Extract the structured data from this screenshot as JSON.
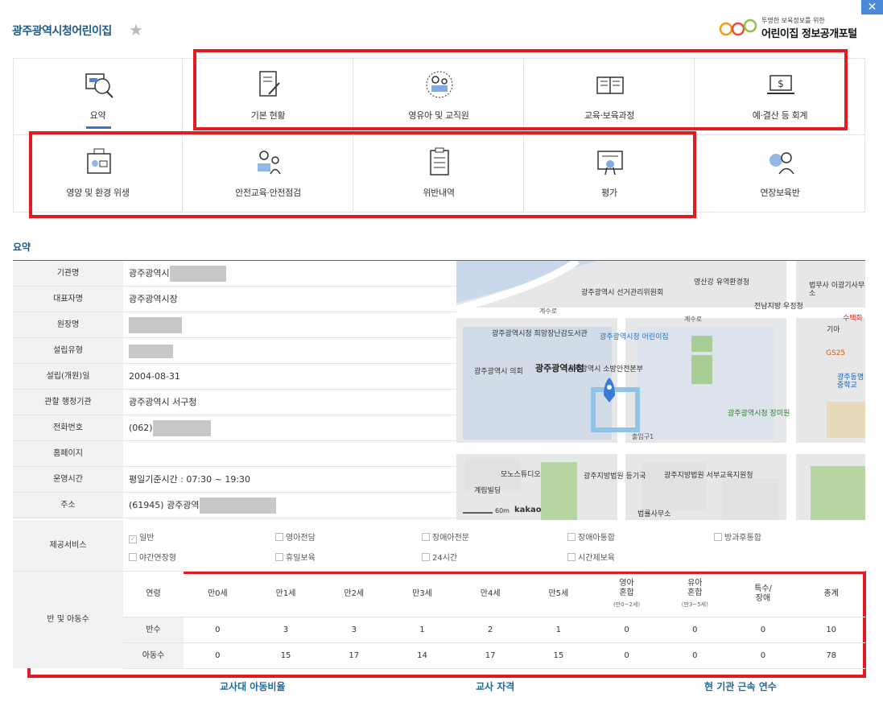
{
  "header": {
    "title": "광주광역시청어린이집",
    "logo_tagline": "투명한 보육정보를 위한",
    "logo_name": "어린이집 정보공개포털"
  },
  "tiles": [
    {
      "label": "요약",
      "icon": "magnifier-chart-icon",
      "active": true
    },
    {
      "label": "기본 현황",
      "icon": "notebook-pen-icon"
    },
    {
      "label": "영유아 및 교직원",
      "icon": "teacher-child-icon"
    },
    {
      "label": "교육·보육과정",
      "icon": "open-book-icon"
    },
    {
      "label": "예·결산 등 회계",
      "icon": "laptop-dollar-icon"
    },
    {
      "label": "영양 및 환경 위생",
      "icon": "chef-meal-icon"
    },
    {
      "label": "안전교육·안전점검",
      "icon": "safety-people-icon"
    },
    {
      "label": "위반내역",
      "icon": "clipboard-checklist-icon"
    },
    {
      "label": "평가",
      "icon": "certificate-icon"
    },
    {
      "label": "연장보육반",
      "icon": "night-care-icon"
    }
  ],
  "section_title": "요약",
  "info": [
    {
      "key": "기관명",
      "value": "광주광역시"
    },
    {
      "key": "대표자명",
      "value": "광주광역시장"
    },
    {
      "key": "원장명",
      "value": ""
    },
    {
      "key": "설립유형",
      "value": ""
    },
    {
      "key": "설립(개원)일",
      "value": "2004-08-31"
    },
    {
      "key": "관할 행정기관",
      "value": "광주광역시 서구청"
    },
    {
      "key": "전화번호",
      "value": "(062)"
    },
    {
      "key": "홈페이지",
      "value": ""
    },
    {
      "key": "운영시간",
      "value": "평일기준시간 : 07:30 ~ 19:30"
    },
    {
      "key": "주소",
      "value": "(61945) 광주광역"
    }
  ],
  "services": {
    "key": "제공서비스",
    "items": [
      {
        "label": "일반",
        "checked": true
      },
      {
        "label": "영아전담",
        "checked": false
      },
      {
        "label": "장애아전문",
        "checked": false
      },
      {
        "label": "장애아통합",
        "checked": false
      },
      {
        "label": "방과후통합",
        "checked": false
      },
      {
        "label": "야간연장형",
        "checked": false
      },
      {
        "label": "휴일보육",
        "checked": false
      },
      {
        "label": "24시간",
        "checked": false
      },
      {
        "label": "시간제보육",
        "checked": false
      }
    ]
  },
  "classes": {
    "key": "반 및 아동수",
    "header_label": "연령",
    "columns": [
      {
        "label": "만0세",
        "sub": ""
      },
      {
        "label": "만1세",
        "sub": ""
      },
      {
        "label": "만2세",
        "sub": ""
      },
      {
        "label": "만3세",
        "sub": ""
      },
      {
        "label": "만4세",
        "sub": ""
      },
      {
        "label": "만5세",
        "sub": ""
      },
      {
        "label": "영아\n혼합",
        "sub": "(만0~2세)"
      },
      {
        "label": "유아\n혼합",
        "sub": "(만3~5세)"
      },
      {
        "label": "특수/\n장애",
        "sub": ""
      },
      {
        "label": "총계",
        "sub": ""
      }
    ],
    "rows": [
      {
        "label": "반수",
        "values": [
          "0",
          "3",
          "3",
          "1",
          "2",
          "1",
          "0",
          "0",
          "0",
          "10"
        ]
      },
      {
        "label": "아동수",
        "values": [
          "0",
          "15",
          "17",
          "14",
          "17",
          "15",
          "0",
          "0",
          "0",
          "78"
        ]
      }
    ]
  },
  "links": [
    "교사대 아동비율",
    "교사 자격",
    "현 기관 근속 연수"
  ],
  "map": {
    "labels": [
      "광주광역시 선거관리위원회",
      "영산강 유역환경청",
      "전남지방 우정청",
      "법무사 이광기사무소",
      "계수로",
      "계수로",
      "광주광역시청 희망장난감도서관",
      "광주광역시청 어린이집",
      "광주광역시청",
      "광주광역시 의회",
      "광주광역시 소방안전본부",
      "광주광역시청 장미원",
      "수백화",
      "GS25",
      "광주동명 중학교",
      "모노스튜디오",
      "계림빌딩",
      "광주지방법원 등기국",
      "광주지방법원 서부교육지원청",
      "법률사무소",
      "출입구1",
      "기아"
    ],
    "scale": "60m",
    "brand": "kakao"
  }
}
